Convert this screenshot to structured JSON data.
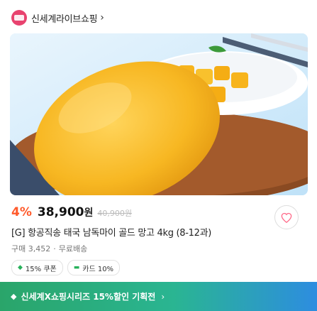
{
  "header": {
    "store_name": "신세계라이브쇼핑",
    "chevron": "›"
  },
  "product": {
    "image_alt": "mango product photo",
    "discount": "4%",
    "price": "38,900",
    "currency": "원",
    "original_price": "40,900원",
    "title": "[G] 항공직송 태국 남독마이 골드 망고 4kg (8-12과)",
    "purchase_count": "구매 3,452",
    "delivery": "무료배송",
    "badges": [
      {
        "label": "15% 쿠폰",
        "icon": "coupon-icon"
      },
      {
        "label": "카드 10%",
        "icon": "card-icon"
      }
    ]
  },
  "banner": {
    "text": "신세계X쇼핑시리즈 15%할인 기획전",
    "chevron": "›",
    "icon": "diamond-icon"
  },
  "colors": {
    "accent": "#ff5a2b",
    "brand": "#e8436f",
    "banner_start": "#2aa56a",
    "banner_end": "#2d8de0"
  }
}
